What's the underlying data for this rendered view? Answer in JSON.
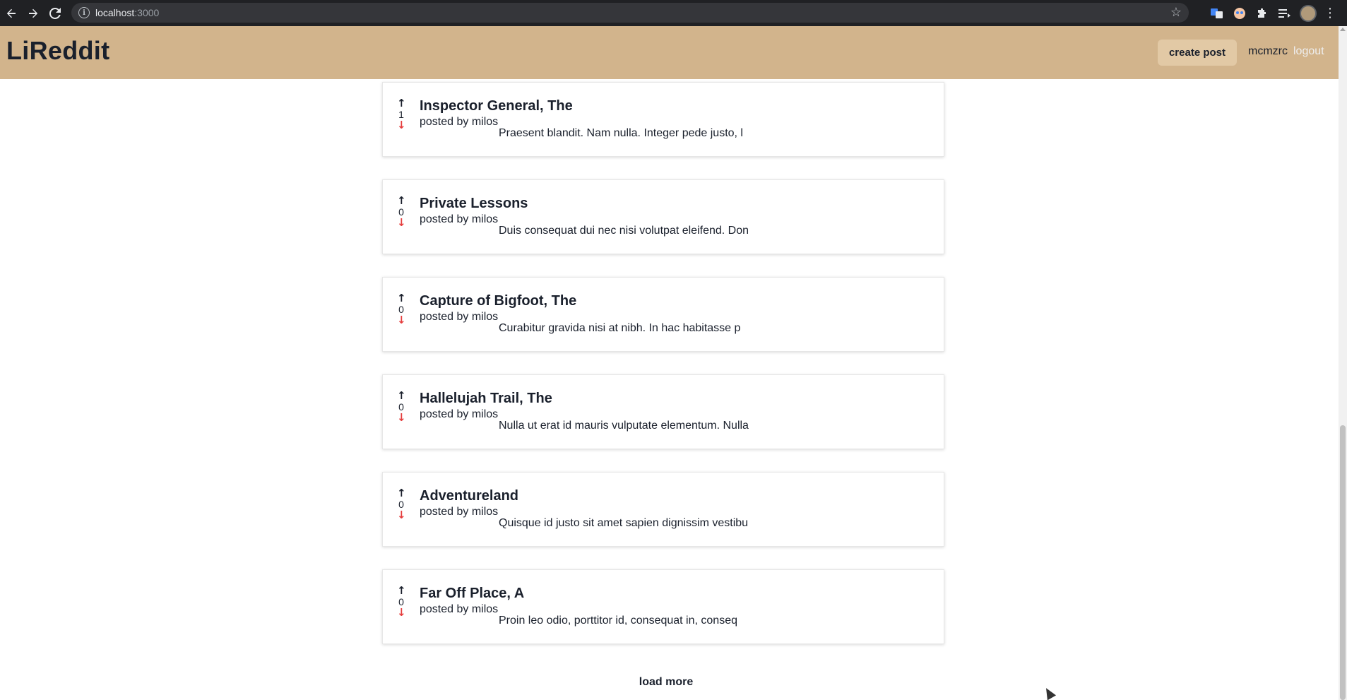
{
  "browser": {
    "url_host": "localhost",
    "url_port": ":3000",
    "back_icon": "arrow-left",
    "forward_icon": "arrow-right",
    "reload_icon": "reload",
    "info_icon": "i",
    "star_icon": "☆",
    "extensions_icon": "puzzle",
    "menu_icon": "⋮"
  },
  "navbar": {
    "brand": "LiReddit",
    "create_post_label": "create post",
    "username": "mcmzrc",
    "logout_label": "logout",
    "background_color": "#d2b48c"
  },
  "posts": [
    {
      "title": "Inspector General, The",
      "author": "posted by milos",
      "points": "1",
      "snippet": "Praesent blandit. Nam nulla. Integer pede justo, l"
    },
    {
      "title": "Private Lessons",
      "author": "posted by milos",
      "points": "0",
      "snippet": "Duis consequat dui nec nisi volutpat eleifend. Don"
    },
    {
      "title": "Capture of Bigfoot, The",
      "author": "posted by milos",
      "points": "0",
      "snippet": "Curabitur gravida nisi at nibh. In hac habitasse p"
    },
    {
      "title": "Hallelujah Trail, The",
      "author": "posted by milos",
      "points": "0",
      "snippet": "Nulla ut erat id mauris vulputate elementum. Nulla"
    },
    {
      "title": "Adventureland",
      "author": "posted by milos",
      "points": "0",
      "snippet": "Quisque id justo sit amet sapien dignissim vestibu"
    },
    {
      "title": "Far Off Place, A",
      "author": "posted by milos",
      "points": "0",
      "snippet": "Proin leo odio, porttitor id, consequat in, conseq"
    }
  ],
  "load_more_label": "load more",
  "colors": {
    "upvote": "#1a202c",
    "downvote": "#e53e3e"
  }
}
